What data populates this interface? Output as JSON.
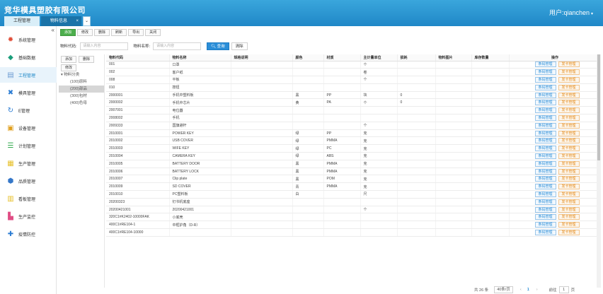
{
  "header": {
    "company": "竞华模具塑胶有限公司",
    "user": "用户:qianchen",
    "user_caret": "▾"
  },
  "tabs": [
    {
      "label": "工程管理"
    },
    {
      "label": "物料信息",
      "close": "×"
    }
  ],
  "tab_more": "⌄",
  "sidebar": {
    "collapse": "«",
    "items": [
      {
        "label": "系统管理",
        "icon": "gear-icon",
        "color": "#e04e39"
      },
      {
        "label": "基础数据",
        "icon": "cube-icon",
        "color": "#1a9d7a"
      },
      {
        "label": "工程管理",
        "icon": "book-icon",
        "color": "#6c9bd2",
        "active": true
      },
      {
        "label": "模具管理",
        "icon": "tool-icon",
        "color": "#2b7cd3"
      },
      {
        "label": "E管理",
        "icon": "recycle-icon",
        "color": "#2b7cd3"
      },
      {
        "label": "设备管理",
        "icon": "chest-icon",
        "color": "#e0a020"
      },
      {
        "label": "计划管理",
        "icon": "plan-icon",
        "color": "#2da84a"
      },
      {
        "label": "生产管理",
        "icon": "table-icon",
        "color": "#e7c02a"
      },
      {
        "label": "品质管理",
        "icon": "shield-icon",
        "color": "#3577c8"
      },
      {
        "label": "看板管理",
        "icon": "board-icon",
        "color": "#e7c02a"
      },
      {
        "label": "生产监控",
        "icon": "factory-icon",
        "color": "#e04e85"
      },
      {
        "label": "疫情防控",
        "icon": "plus-icon",
        "color": "#2b7cd3"
      }
    ]
  },
  "toolbar": {
    "add": "添加",
    "edit": "修改",
    "delete": "删除",
    "refresh": "刷新",
    "export": "导出",
    "close": "关闭"
  },
  "search": {
    "code_label": "物料代码:",
    "code_placeholder": "请输入内容",
    "name_label": "物料名称:",
    "name_placeholder": "请输入内容",
    "search_button": "查询",
    "clear_button": "清除"
  },
  "tree": {
    "add": "添加",
    "delete": "删除",
    "edit": "修改",
    "root": "物料分类",
    "nodes": [
      "(100)原料",
      "(200)部品",
      "(300)包材",
      "(400)色母"
    ]
  },
  "table": {
    "headers": [
      "物料代码",
      "物料名称",
      "规格说明",
      "颜色",
      "材质",
      "主计量单位",
      "损耗",
      "物料图片",
      "库存数量",
      "操作"
    ],
    "ops": {
      "btn1": "条码管理",
      "btn2": "发卡管理"
    },
    "rows": [
      [
        "001",
        "口罩",
        "",
        "",
        "",
        "个",
        "",
        "",
        ""
      ],
      [
        "002",
        "客户纸",
        "",
        "",
        "",
        "卷",
        "",
        "",
        ""
      ],
      [
        "008",
        "平板",
        "",
        "",
        "",
        "个",
        "",
        "",
        ""
      ],
      [
        "010",
        "按钮",
        "",
        "",
        "",
        "",
        "",
        "",
        ""
      ],
      [
        "2000001",
        "手机中塑料板",
        "",
        "黑",
        "PP",
        "块",
        "0",
        "",
        ""
      ],
      [
        "2000002",
        "手机中芯片",
        "",
        "黄",
        "PA",
        "个",
        "0",
        "",
        ""
      ],
      [
        "2007001",
        "电位器",
        "",
        "",
        "",
        "",
        "",
        "",
        ""
      ],
      [
        "2008002",
        "手机",
        "",
        "",
        "",
        "",
        "",
        "",
        ""
      ],
      [
        "2009333",
        "国旗避杆",
        "",
        "",
        "",
        "个",
        "",
        "",
        ""
      ],
      [
        "2010001",
        "POWER KEY",
        "",
        "绿",
        "PP",
        "克",
        "",
        "",
        ""
      ],
      [
        "2010002",
        "USB COVER",
        "",
        "绿",
        "PMMA",
        "克",
        "",
        "",
        ""
      ],
      [
        "2010003",
        "WIFE KEY",
        "",
        "绿",
        "PC",
        "克",
        "",
        "",
        ""
      ],
      [
        "2010004",
        "CAMERA KEY",
        "",
        "绿",
        "ABS",
        "克",
        "",
        "",
        ""
      ],
      [
        "2010005",
        "BATTERY DOOR",
        "",
        "黑",
        "PMMA",
        "克",
        "",
        "",
        ""
      ],
      [
        "2010006",
        "BATTERY LOCK",
        "",
        "黑",
        "PMMA",
        "克",
        "",
        "",
        ""
      ],
      [
        "2010007",
        "Clip plate",
        "",
        "黑",
        "POM",
        "克",
        "",
        "",
        ""
      ],
      [
        "2010009",
        "SD COVER",
        "",
        "青",
        "PMMA",
        "克",
        "",
        "",
        ""
      ],
      [
        "2010010",
        "PC塑料板",
        "",
        "白",
        "",
        "尺",
        "",
        "",
        ""
      ],
      [
        "20200323",
        "钉书机底座",
        "",
        "",
        "",
        "",
        "",
        "",
        ""
      ],
      [
        "20200421001",
        "20200421001",
        "",
        "",
        "",
        "个",
        "",
        "",
        ""
      ],
      [
        "320C1#K2402-10000FAK",
        "小底壳",
        "",
        "",
        "",
        "",
        "",
        "",
        ""
      ],
      [
        "400C1#RE104-1",
        "中框护角（D-R）",
        "",
        "",
        "",
        "",
        "",
        "",
        ""
      ],
      [
        "400C1#RE104-10000",
        "",
        "",
        "",
        "",
        "",
        "",
        "",
        ""
      ]
    ]
  },
  "pager": {
    "total": "共 26 条",
    "size": "40条/页",
    "prev": "‹",
    "page": "1",
    "next": "›",
    "goto": "前往",
    "goto_value": "1",
    "unit": "页"
  }
}
